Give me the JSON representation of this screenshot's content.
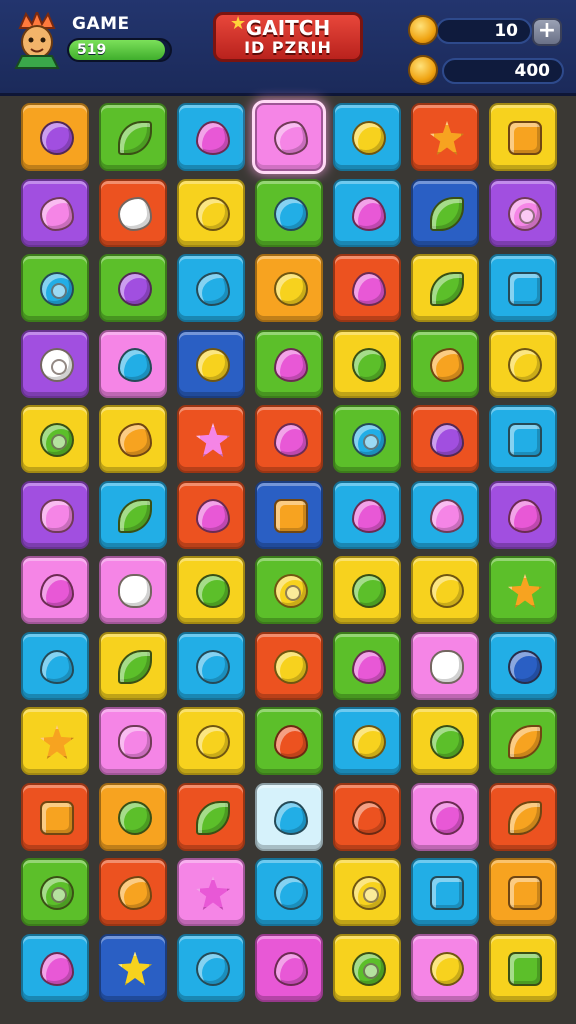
{
  "hud": {
    "player_name": "GAME",
    "xp_value": "519",
    "xp_progress": 0.95,
    "logo_line1": "GAITCH",
    "logo_line2": "ID PZRIH",
    "coins": "10",
    "plus_label": "+",
    "gold": "400"
  },
  "colors": {
    "orange": "#f7a320",
    "green": "#5cbf2a",
    "blue": "#22aee6",
    "pink": "#f585e6",
    "yellow": "#f7d21e",
    "red": "#ec5220",
    "purple": "#a14fe0",
    "navy": "#2a5fc4",
    "lime": "#8fcc2a",
    "pale": "#d6f2fb",
    "magenta": "#e858d6"
  },
  "board": {
    "rows": [
      [
        [
          "orange",
          "circle",
          "purple"
        ],
        [
          "green",
          "leaf",
          "green"
        ],
        [
          "blue",
          "heart",
          "magenta"
        ],
        [
          "pink",
          "blob",
          "pink"
        ],
        [
          "blue",
          "circle",
          "yellow"
        ],
        [
          "red",
          "star",
          "orange"
        ],
        [
          "yellow",
          "square",
          "orange"
        ]
      ],
      [
        [
          "purple",
          "blob",
          "pink"
        ],
        [
          "red",
          "blob",
          "white"
        ],
        [
          "yellow",
          "circle",
          "yellow"
        ],
        [
          "green",
          "circle",
          "blue"
        ],
        [
          "blue",
          "heart",
          "magenta"
        ],
        [
          "navy",
          "leaf",
          "green"
        ],
        [
          "purple",
          "ring",
          "pink"
        ]
      ],
      [
        [
          "green",
          "ring",
          "blue"
        ],
        [
          "green",
          "circle",
          "purple"
        ],
        [
          "blue",
          "blob",
          "blue"
        ],
        [
          "orange",
          "circle",
          "yellow"
        ],
        [
          "red",
          "heart",
          "magenta"
        ],
        [
          "yellow",
          "leaf",
          "green"
        ],
        [
          "blue",
          "square",
          "blue"
        ]
      ],
      [
        [
          "purple",
          "ring",
          "white"
        ],
        [
          "pink",
          "heart",
          "blue"
        ],
        [
          "navy",
          "circle",
          "yellow"
        ],
        [
          "green",
          "heart",
          "magenta"
        ],
        [
          "yellow",
          "circle",
          "green"
        ],
        [
          "green",
          "blob",
          "orange"
        ],
        [
          "yellow",
          "circle",
          "yellow"
        ]
      ],
      [
        [
          "yellow",
          "ring",
          "green"
        ],
        [
          "yellow",
          "blob",
          "orange"
        ],
        [
          "red",
          "star",
          "pink"
        ],
        [
          "red",
          "heart",
          "magenta"
        ],
        [
          "green",
          "ring",
          "blue"
        ],
        [
          "red",
          "heart",
          "purple"
        ],
        [
          "blue",
          "square",
          "blue"
        ]
      ],
      [
        [
          "purple",
          "flower",
          "pink"
        ],
        [
          "blue",
          "leaf",
          "green"
        ],
        [
          "red",
          "heart",
          "magenta"
        ],
        [
          "navy",
          "square",
          "orange"
        ],
        [
          "blue",
          "heart",
          "magenta"
        ],
        [
          "blue",
          "heart",
          "pink"
        ],
        [
          "purple",
          "heart",
          "magenta"
        ]
      ],
      [
        [
          "pink",
          "heart",
          "magenta"
        ],
        [
          "pink",
          "flower",
          "white"
        ],
        [
          "yellow",
          "circle",
          "green"
        ],
        [
          "green",
          "ring",
          "yellow"
        ],
        [
          "yellow",
          "circle",
          "green"
        ],
        [
          "yellow",
          "circle",
          "yellow"
        ],
        [
          "green",
          "star",
          "orange"
        ]
      ],
      [
        [
          "blue",
          "heart",
          "blue"
        ],
        [
          "yellow",
          "leaf",
          "green"
        ],
        [
          "blue",
          "circle",
          "blue"
        ],
        [
          "red",
          "circle",
          "yellow"
        ],
        [
          "green",
          "heart",
          "magenta"
        ],
        [
          "pink",
          "flower",
          "white"
        ],
        [
          "blue",
          "circle",
          "navy"
        ]
      ],
      [
        [
          "yellow",
          "star",
          "orange"
        ],
        [
          "pink",
          "flower",
          "pink"
        ],
        [
          "yellow",
          "circle",
          "yellow"
        ],
        [
          "green",
          "heart",
          "red"
        ],
        [
          "blue",
          "circle",
          "yellow"
        ],
        [
          "yellow",
          "circle",
          "green"
        ],
        [
          "green",
          "leaf",
          "orange"
        ]
      ],
      [
        [
          "red",
          "square",
          "orange"
        ],
        [
          "orange",
          "circle",
          "green"
        ],
        [
          "red",
          "leaf",
          "green"
        ],
        [
          "pale",
          "heart",
          "blue"
        ],
        [
          "red",
          "heart",
          "red"
        ],
        [
          "pink",
          "circle",
          "magenta"
        ],
        [
          "red",
          "leaf",
          "orange"
        ]
      ],
      [
        [
          "green",
          "ring",
          "green"
        ],
        [
          "red",
          "blob",
          "orange"
        ],
        [
          "pink",
          "star",
          "magenta"
        ],
        [
          "blue",
          "circle",
          "blue"
        ],
        [
          "yellow",
          "ring",
          "yellow"
        ],
        [
          "blue",
          "square",
          "blue"
        ],
        [
          "orange",
          "square",
          "orange"
        ]
      ],
      [
        [
          "blue",
          "heart",
          "magenta"
        ],
        [
          "navy",
          "star",
          "yellow"
        ],
        [
          "blue",
          "circle",
          "blue"
        ],
        [
          "magenta",
          "heart",
          "magenta"
        ],
        [
          "yellow",
          "ring",
          "green"
        ],
        [
          "pink",
          "circle",
          "yellow"
        ],
        [
          "yellow",
          "square",
          "green"
        ]
      ]
    ],
    "selected": [
      0,
      3
    ]
  }
}
